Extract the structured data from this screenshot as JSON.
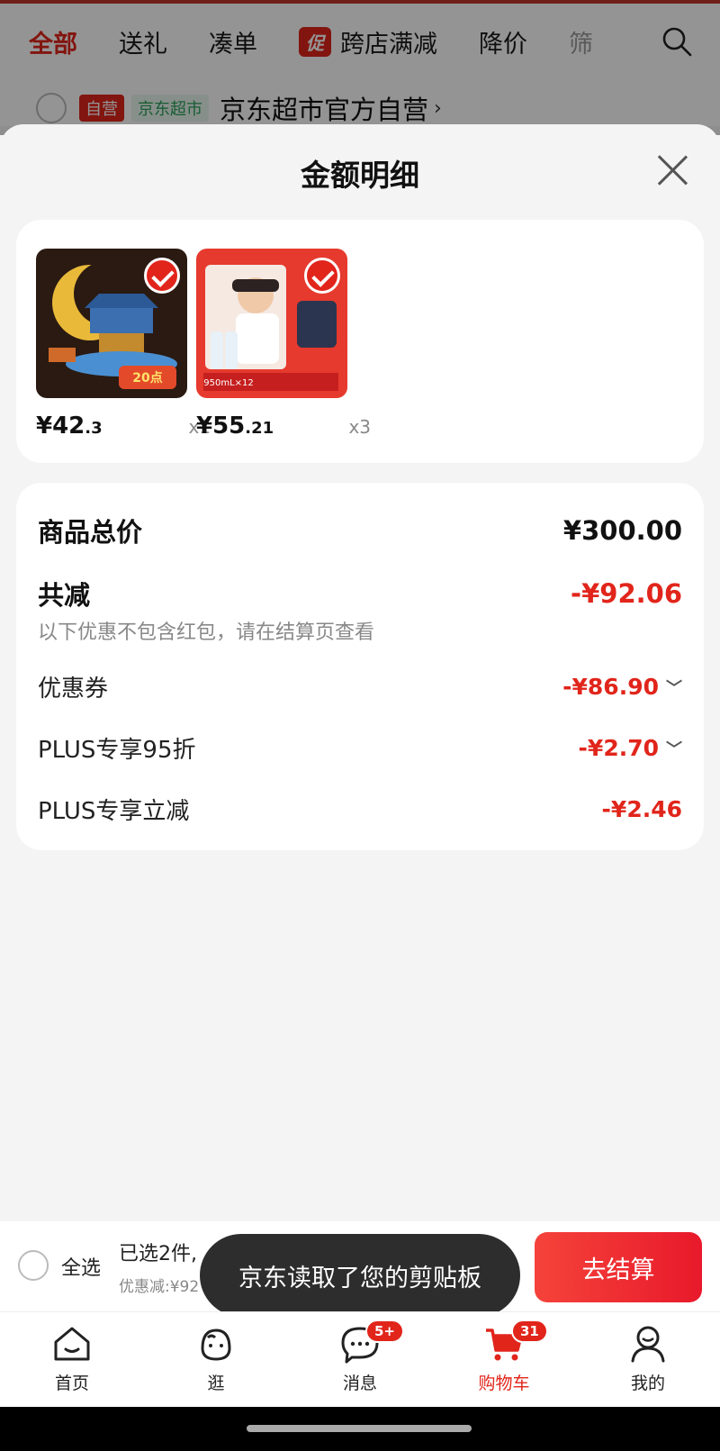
{
  "filter_tabs": [
    {
      "label": "全部"
    },
    {
      "label": "送礼"
    },
    {
      "label": "凑单"
    },
    {
      "label": "跨店满减",
      "badge": "促"
    },
    {
      "label": "降价"
    },
    {
      "label": "筛"
    }
  ],
  "store": {
    "tag_self": "自营",
    "tag_super": "京东超市",
    "name": "京东超市官方自营"
  },
  "sheet": {
    "title": "金额明细"
  },
  "products": [
    {
      "price_int": "¥42",
      "price_dec": ".3",
      "qty": "x1"
    },
    {
      "price_int": "¥55",
      "price_dec": ".21",
      "qty": "x3"
    }
  ],
  "summary": {
    "total_label": "商品总价",
    "total_value": "¥300.00",
    "reduce_label": "共减",
    "reduce_value": "-¥92.06",
    "note": "以下优惠不包含红包，请在结算页查看",
    "lines": [
      {
        "label": "优惠券",
        "value": "-¥86.90"
      },
      {
        "label": "PLUS专享95折",
        "value": "-¥2.70"
      },
      {
        "label": "PLUS专享立减",
        "value": "-¥2.46"
      }
    ]
  },
  "checkout": {
    "select_all": "全选",
    "selected": "已选2件,",
    "discount": "优惠减:¥92",
    "button": "去结算"
  },
  "toast": "京东读取了您的剪贴板",
  "tabbar": [
    {
      "label": "首页",
      "icon": "home-icon"
    },
    {
      "label": "逛",
      "icon": "explore-icon"
    },
    {
      "label": "消息",
      "icon": "message-icon",
      "badge": "5+"
    },
    {
      "label": "购物车",
      "icon": "cart-icon",
      "badge": "31"
    },
    {
      "label": "我的",
      "icon": "profile-icon"
    }
  ],
  "colors": {
    "accent": "#e1251b",
    "toast_bg": "#2d2d2d"
  }
}
